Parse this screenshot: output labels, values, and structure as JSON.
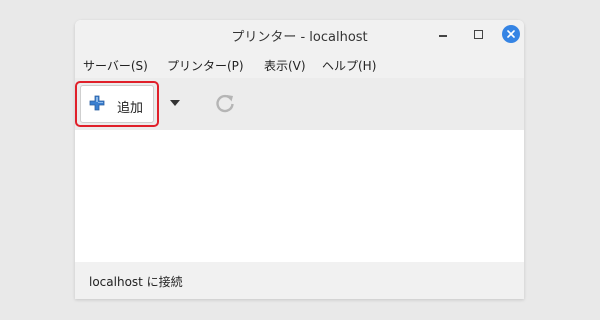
{
  "window": {
    "title": "プリンター - localhost"
  },
  "menu": {
    "items": [
      {
        "label": "サーバー(S)"
      },
      {
        "label": "プリンター(P)"
      },
      {
        "label": "表示(V)"
      },
      {
        "label": "ヘルプ(H)"
      }
    ]
  },
  "toolbar": {
    "add_label": "追加",
    "add_icon": "plus-icon",
    "dropdown_icon": "chevron-down-icon",
    "refresh_icon": "refresh-icon",
    "highlight_color": "#e0202a"
  },
  "status": {
    "text": "localhost に接続"
  },
  "colors": {
    "accent": "#3584e4",
    "plus_icon": "#3a7fd0"
  }
}
